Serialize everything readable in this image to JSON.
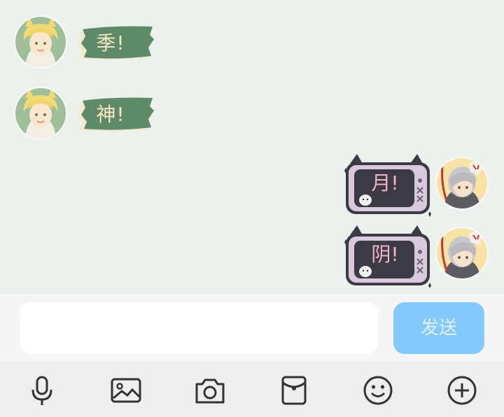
{
  "messages": [
    {
      "side": "left",
      "text": "季!"
    },
    {
      "side": "left",
      "text": "神!"
    },
    {
      "side": "right",
      "text": "月!"
    },
    {
      "side": "right",
      "text": "阴!"
    }
  ],
  "composer": {
    "placeholder": "",
    "send_label": "发送",
    "send_color": "#84c9fb"
  },
  "toolbar": {
    "icons": [
      "microphone-icon",
      "image-icon",
      "camera-icon",
      "red-envelope-icon",
      "emoji-icon",
      "plus-icon"
    ]
  },
  "colors": {
    "chat_background": "#edf1ed",
    "left_bubble": "#5e8a6a",
    "right_bubble": "#d9c9dc"
  }
}
